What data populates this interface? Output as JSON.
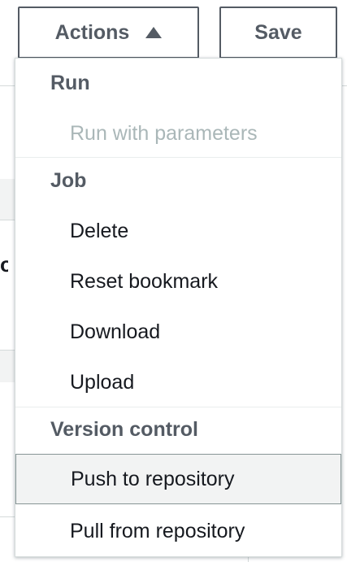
{
  "toolbar": {
    "actions_label": "Actions",
    "save_label": "Save"
  },
  "menu": {
    "groups": [
      {
        "header": "Run",
        "items": [
          {
            "label": "Run with parameters",
            "disabled": true
          }
        ]
      },
      {
        "header": "Job",
        "items": [
          {
            "label": "Delete"
          },
          {
            "label": "Reset bookmark"
          },
          {
            "label": "Download"
          },
          {
            "label": "Upload"
          }
        ]
      },
      {
        "header": "Version control",
        "items": [
          {
            "label": "Push to repository",
            "highlighted": true
          },
          {
            "label": "Pull from repository"
          }
        ]
      }
    ]
  },
  "icons": {
    "actions_caret": "caret-up-icon"
  },
  "colors": {
    "text": "#16191f",
    "muted": "#545b64",
    "disabled": "#aab7b8",
    "highlight_bg": "#f2f3f3",
    "highlight_border": "#879596"
  }
}
